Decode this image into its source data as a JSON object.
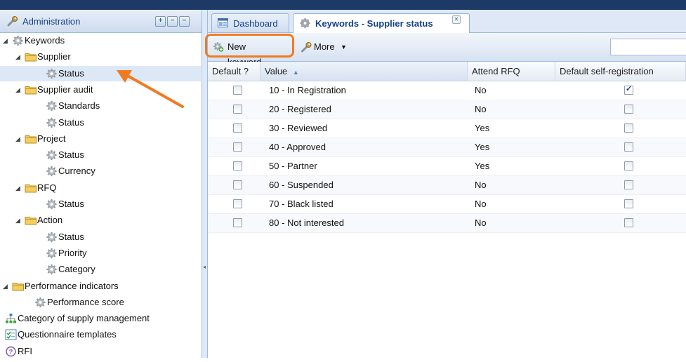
{
  "left_panel": {
    "title": "Administration",
    "header_buttons": [
      "+",
      "−",
      "−"
    ],
    "tree": [
      {
        "label": "Keywords",
        "type": "keyword-group",
        "level": 0,
        "expanded": true
      },
      {
        "label": "Supplier",
        "type": "folder",
        "level": 1,
        "expanded": true
      },
      {
        "label": "Status",
        "type": "gear",
        "level": 2,
        "selected": true
      },
      {
        "label": "Supplier audit",
        "type": "folder",
        "level": 1,
        "expanded": true
      },
      {
        "label": "Standards",
        "type": "gear",
        "level": 2
      },
      {
        "label": "Status",
        "type": "gear",
        "level": 2
      },
      {
        "label": "Project",
        "type": "folder",
        "level": 1,
        "expanded": true
      },
      {
        "label": "Status",
        "type": "gear",
        "level": 2
      },
      {
        "label": "Currency",
        "type": "gear",
        "level": 2
      },
      {
        "label": "RFQ",
        "type": "folder",
        "level": 1,
        "expanded": true
      },
      {
        "label": "Status",
        "type": "gear",
        "level": 2
      },
      {
        "label": "Action",
        "type": "folder",
        "level": 1,
        "expanded": true
      },
      {
        "label": "Status",
        "type": "gear",
        "level": 2
      },
      {
        "label": "Priority",
        "type": "gear",
        "level": 2
      },
      {
        "label": "Category",
        "type": "gear",
        "level": 2
      },
      {
        "label": "Performance indicators",
        "type": "folder",
        "level": 0,
        "expanded": true
      },
      {
        "label": "Performance score",
        "type": "gear",
        "level": 1
      },
      {
        "label": "Category of supply management",
        "type": "hierarchy",
        "level": 0
      },
      {
        "label": "Questionnaire templates",
        "type": "questionnaire",
        "level": 0
      },
      {
        "label": "RFI",
        "type": "rfi",
        "level": 0
      }
    ]
  },
  "tabs": [
    {
      "label": "Dashboard",
      "icon": "dashboard-icon",
      "active": false
    },
    {
      "label": "Keywords - Supplier status",
      "icon": "gear-icon",
      "active": true,
      "closable": true
    }
  ],
  "toolbar": {
    "new_keyword_label": "New keyword",
    "more_label": "More",
    "search_placeholder": ""
  },
  "grid": {
    "columns": [
      "Default ?",
      "Value",
      "Attend RFQ",
      "Default self-registration"
    ],
    "sorted_column": "Value",
    "rows": [
      {
        "default": false,
        "value": "10 - In Registration",
        "attend_rfq": "No",
        "self_registration": true
      },
      {
        "default": false,
        "value": "20 - Registered",
        "attend_rfq": "No",
        "self_registration": false
      },
      {
        "default": false,
        "value": "30 - Reviewed",
        "attend_rfq": "Yes",
        "self_registration": false
      },
      {
        "default": false,
        "value": "40 - Approved",
        "attend_rfq": "Yes",
        "self_registration": false
      },
      {
        "default": false,
        "value": "50 - Partner",
        "attend_rfq": "Yes",
        "self_registration": false
      },
      {
        "default": false,
        "value": "60 - Suspended",
        "attend_rfq": "No",
        "self_registration": false
      },
      {
        "default": false,
        "value": "70 - Black listed",
        "attend_rfq": "No",
        "self_registration": false
      },
      {
        "default": false,
        "value": "80 - Not interested",
        "attend_rfq": "No",
        "self_registration": false
      }
    ]
  },
  "colors": {
    "header_blue": "#15428b",
    "selection": "#dde8f7",
    "highlight_orange": "#ef7b22",
    "topbar": "#1d3a66"
  }
}
